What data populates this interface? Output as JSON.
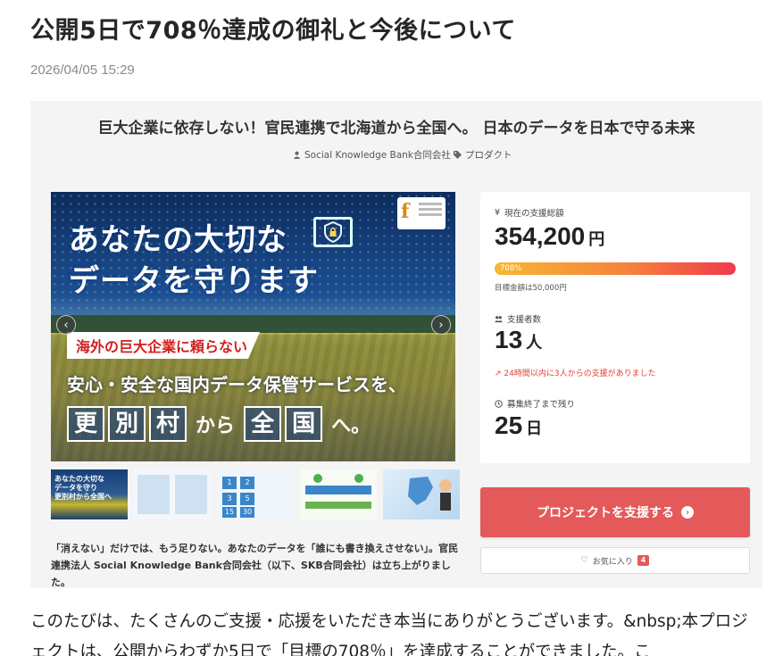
{
  "article": {
    "title": "公開5日で708％達成の御礼と今後について",
    "date": "2026/04/05 15:29",
    "body": "このたびは、たくさんのご支援・応援をいただき本当にありがとうございます。&nbsp;本プロジェクトは、公開からわずか5日で「目標の708％」を達成することができました。こ"
  },
  "project": {
    "title": "巨大企業に依存しない！官民連携で北海道から全国へ。 日本のデータを日本で守る未来",
    "author": "Social Knowledge Bank合同会社",
    "category": "プロダクト",
    "lead": "「消えない」だけでは、もう足りない。あなたのデータを「誰にも書き換えさせない」。官民連携法人 Social Knowledge Bank合同会社（以下、SKB合同会社）は立ち上がりました。"
  },
  "hero": {
    "line1": "あなたの大切な",
    "line2": "データを守ります",
    "band": "海外の巨大企業に頼らない",
    "line3": "安心・安全な国内データ保管サービスを、",
    "line4_boxes1": [
      "更",
      "別",
      "村"
    ],
    "line4_mid": "から",
    "line4_boxes2": [
      "全",
      "国"
    ],
    "line4_end": "へ。"
  },
  "thumbnails": {
    "t1_text": "あなたの大切な\nデータを守り\n更別村から全国へ"
  },
  "stats": {
    "funding_label": "現在の支援総額",
    "funding_amount": "354,200",
    "funding_unit": "円",
    "progress_label": "708%",
    "progress_fraction": 1.0,
    "goal_text": "目標金額は50,000円",
    "backers_label": "支援者数",
    "backers_count": "13",
    "backers_unit": "人",
    "trend_text": "24時間以内に3人からの支援がありました",
    "remaining_label": "募集終了まで残り",
    "remaining_days": "25",
    "remaining_unit": "日"
  },
  "actions": {
    "support_label": "プロジェクトを支援する",
    "favorite_label": "お気に入り",
    "favorite_count": "4"
  },
  "colors": {
    "accent_red": "#e45959",
    "progress_start": "#f7b733",
    "progress_end": "#f0394e"
  }
}
